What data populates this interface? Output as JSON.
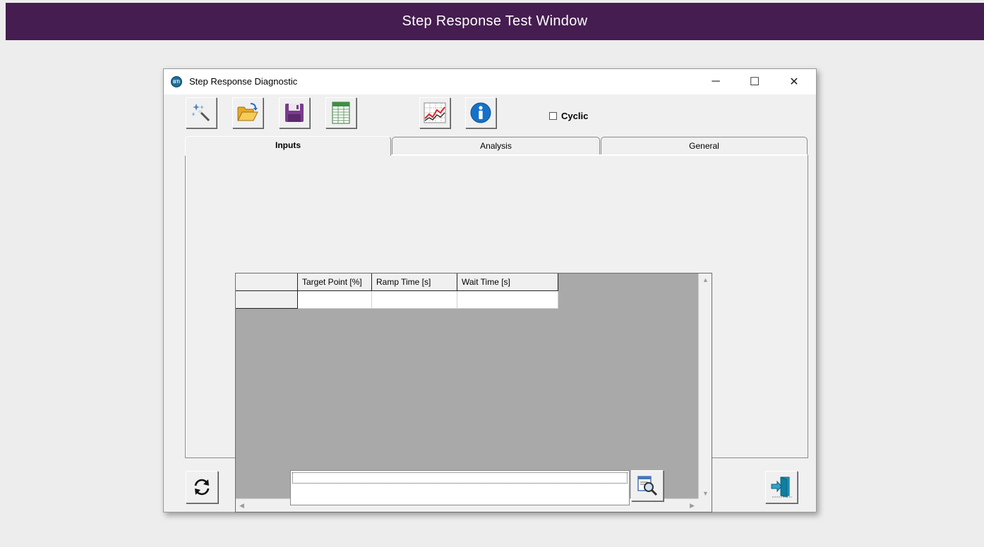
{
  "banner": {
    "title": "Step Response Test Window"
  },
  "window": {
    "title": "Step Response Diagnostic",
    "icon_text": "BTI",
    "controls": {
      "minimize": "─",
      "maximize": "☐",
      "close": "✕"
    }
  },
  "toolbar": {
    "cyclic_label": "Cyclic",
    "cyclic_checked": false
  },
  "tabs": [
    {
      "label": "Inputs",
      "active": true
    },
    {
      "label": "Analysis",
      "active": false
    },
    {
      "label": "General",
      "active": false
    }
  ],
  "grid": {
    "columns": [
      "",
      "Target Point [%]",
      "Ramp Time [s]",
      "Wait Time [s]"
    ],
    "rows": [
      [
        "",
        "",
        "",
        ""
      ]
    ]
  },
  "status": {
    "text": ""
  },
  "colors": {
    "banner": "#451d50",
    "grid_background": "#a9a9a9",
    "window_bg": "#f0f0f0"
  }
}
